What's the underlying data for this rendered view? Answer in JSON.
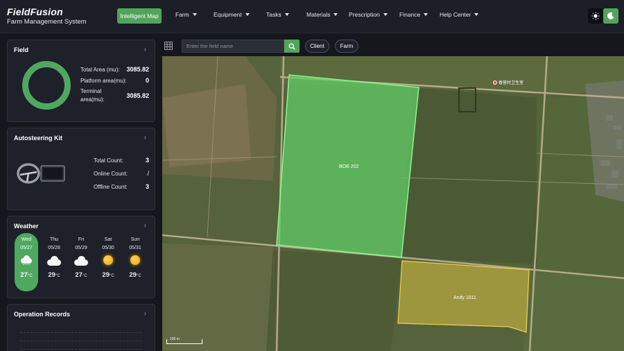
{
  "app": {
    "brand": "FieldFusion",
    "subtitle": "Farm Management System"
  },
  "nav": {
    "active": "Intelligent Map",
    "items": [
      {
        "label": "Farm"
      },
      {
        "label": "Equipment"
      },
      {
        "label": "Tasks"
      },
      {
        "label": "Materials"
      },
      {
        "label": "Prescription"
      },
      {
        "label": "Finance"
      },
      {
        "label": "Help Center"
      }
    ],
    "theme_icons": [
      "sun-icon",
      "moon-icon"
    ]
  },
  "field_card": {
    "title": "Field",
    "rows": [
      {
        "label": "Total Area (mu):",
        "value": "3085.82"
      },
      {
        "label": "Platform area(mu):",
        "value": "0"
      },
      {
        "label": "Terminal area(mu):",
        "value": "3085.82"
      }
    ]
  },
  "kit_card": {
    "title": "Autosteering Kit",
    "rows": [
      {
        "label": "Total Count:",
        "value": "3"
      },
      {
        "label": "Online Count:",
        "value": "/"
      },
      {
        "label": "Offline Count:",
        "value": "3"
      }
    ]
  },
  "weather_card": {
    "title": "Weather",
    "days": [
      {
        "name": "Wed",
        "date": "05/27",
        "temp": "27",
        "unit": "°C",
        "icon": "cloud-rain-icon",
        "active": true
      },
      {
        "name": "Thu",
        "date": "05/28",
        "temp": "29",
        "unit": "°C",
        "icon": "cloud-icon",
        "active": false
      },
      {
        "name": "Fri",
        "date": "05/29",
        "temp": "27",
        "unit": "°C",
        "icon": "cloud-icon",
        "active": false
      },
      {
        "name": "Sat",
        "date": "05/30",
        "temp": "29",
        "unit": "°C",
        "icon": "sun-icon",
        "active": false
      },
      {
        "name": "Sun",
        "date": "05/31",
        "temp": "29",
        "unit": "°C",
        "icon": "sun-icon",
        "active": false
      }
    ]
  },
  "records_card": {
    "title": "Operation Records"
  },
  "map_toolbar": {
    "search_placeholder": "Enter the field name",
    "filters": [
      "Client",
      "Farm"
    ]
  },
  "map": {
    "fields": [
      {
        "name": "BOB 202",
        "color": "#6fe07a"
      },
      {
        "name": "Andy 1011",
        "color": "#e2c94a"
      }
    ],
    "poi": "香营村卫生室",
    "scale_label": "100 m"
  },
  "colors": {
    "accent": "#52a45a",
    "background": "#15171d",
    "card": "#1e2129"
  }
}
